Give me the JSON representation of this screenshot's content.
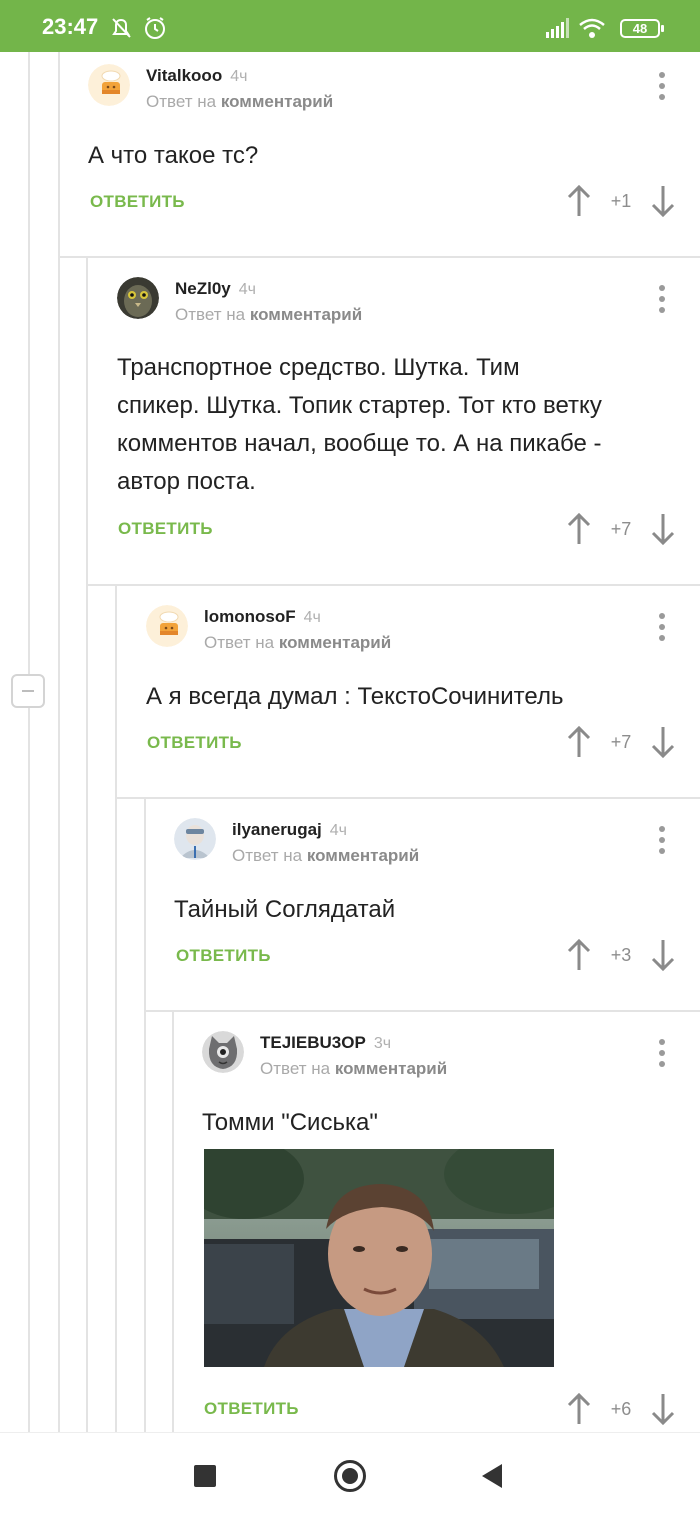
{
  "status_bar": {
    "time": "23:47",
    "battery": "48",
    "bg_color": "#73b54a"
  },
  "comments": [
    {
      "author": "Vitalkooo",
      "time": "4ч",
      "reply_prefix": "Ответ на",
      "reply_target": "комментарий",
      "text": "А что такое тс?",
      "reply_label": "ОТВЕТИТЬ",
      "score": "+1",
      "avatar": "default-avatar-icon"
    },
    {
      "author": "NeZl0y",
      "time": "4ч",
      "reply_prefix": "Ответ на",
      "reply_target": "комментарий",
      "text_lines": [
        "Транспортное средство. Шутка. Тим",
        "спикер. Шутка. Топик стартер. Тот кто ветку",
        "комментов начал, вообще то. А на пикабе -",
        "автор поста."
      ],
      "reply_label": "ОТВЕТИТЬ",
      "score": "+7",
      "avatar": "user-photo-avatar"
    },
    {
      "author": "lomonosoF",
      "time": "4ч",
      "reply_prefix": "Ответ на",
      "reply_target": "комментарий",
      "text": "А я всегда думал : ТекстоСочинитель",
      "reply_label": "ОТВЕТИТЬ",
      "score": "+7",
      "avatar": "default-avatar-icon"
    },
    {
      "author": "ilyanerugaj",
      "time": "4ч",
      "reply_prefix": "Ответ на",
      "reply_target": "комментарий",
      "text": "Тайный Соглядатай",
      "reply_label": "ОТВЕТИТЬ",
      "score": "+3",
      "avatar": "user-photo-avatar"
    },
    {
      "author": "TEJIEBU3OP",
      "time": "3ч",
      "reply_prefix": "Ответ на",
      "reply_target": "комментарий",
      "text": "Томми \"Сиська\"",
      "reply_label": "ОТВЕТИТЬ",
      "score": "+6",
      "avatar": "cat-avatar",
      "attachment": "gif-image"
    }
  ],
  "accent_color": "#79b94c"
}
